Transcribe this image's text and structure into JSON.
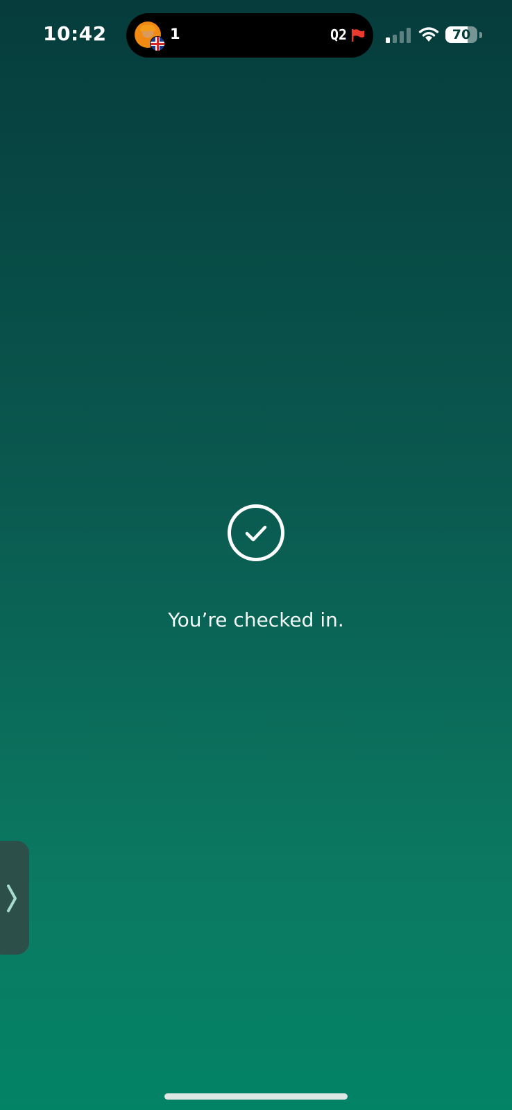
{
  "status_bar": {
    "time": "10:42",
    "battery_percent": "70",
    "battery_level": 0.7,
    "signal_bars_active": 1
  },
  "live_activity": {
    "position": "1",
    "session": "Q2",
    "flag_color": "#e83a2e"
  },
  "confirmation": {
    "icon": "check-circle-icon",
    "message": "You’re checked in."
  },
  "drawer": {
    "icon": "chevron-right-icon"
  },
  "colors": {
    "background_top": "#063c3c",
    "background_bottom": "#038366",
    "drawer_handle": "#2d4f49",
    "chevron": "#a6dccd"
  }
}
